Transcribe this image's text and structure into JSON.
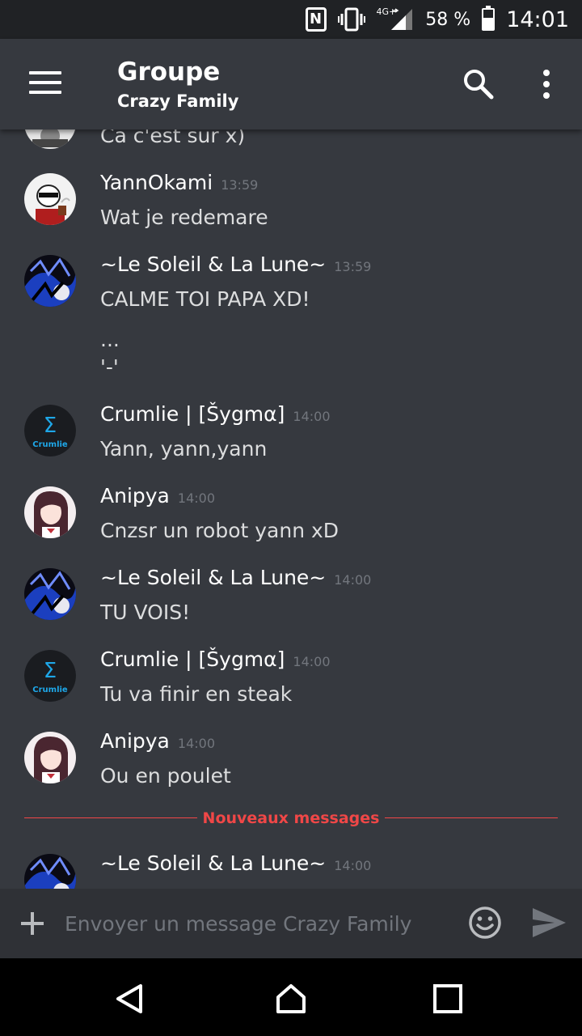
{
  "status_bar": {
    "network": "4G+",
    "battery": "58 %",
    "clock": "14:01",
    "icons": [
      "nfc-icon",
      "vibrate-icon",
      "signal-icon",
      "battery-icon"
    ]
  },
  "app_bar": {
    "title": "Groupe",
    "subtitle": "Crazy Family",
    "icons": [
      "menu-icon",
      "search-icon",
      "more-vert-icon"
    ]
  },
  "messages": {
    "partial_top": {
      "line": "Ca c'est sur x)"
    },
    "groups": [
      {
        "author": "YannOkami",
        "time": "13:59",
        "lines": [
          "Wat je redemare"
        ],
        "avatar": "yann"
      },
      {
        "author": "~Le Soleil & La Lune~",
        "time": "13:59",
        "lines": [
          "CALME TOI PAPA XD!",
          "...",
          "'-'"
        ],
        "avatar": "soleil"
      },
      {
        "author": "Crumlie | [Šygmα]",
        "time": "14:00",
        "lines": [
          "Yann, yann,yann"
        ],
        "avatar": "crumlie",
        "avatar_text": "Crumlie"
      },
      {
        "author": "Anipya",
        "time": "14:00",
        "lines": [
          "Cnzsr un robot yann xD"
        ],
        "avatar": "anipya"
      },
      {
        "author": "~Le Soleil & La Lune~",
        "time": "14:00",
        "lines": [
          "TU VOIS!"
        ],
        "avatar": "soleil"
      },
      {
        "author": "Crumlie | [Šygmα]",
        "time": "14:00",
        "lines": [
          "Tu va finir en steak"
        ],
        "avatar": "crumlie",
        "avatar_text": "Crumlie"
      },
      {
        "author": "Anipya",
        "time": "14:00",
        "lines": [
          "Ou en poulet"
        ],
        "avatar": "anipya"
      }
    ],
    "new_divider": "Nouveaux messages",
    "after_divider": {
      "author": "~Le Soleil & La Lune~",
      "time": "14:00",
      "avatar": "soleil"
    }
  },
  "composer": {
    "placeholder": "Envoyer un message Crazy Family",
    "icons": [
      "add-icon",
      "emoji-icon",
      "send-icon"
    ]
  },
  "colors": {
    "background": "#36393f",
    "status_bar": "#202225",
    "composer": "#2f3136",
    "new_messages": "#f04747",
    "timestamp": "#72767d"
  }
}
